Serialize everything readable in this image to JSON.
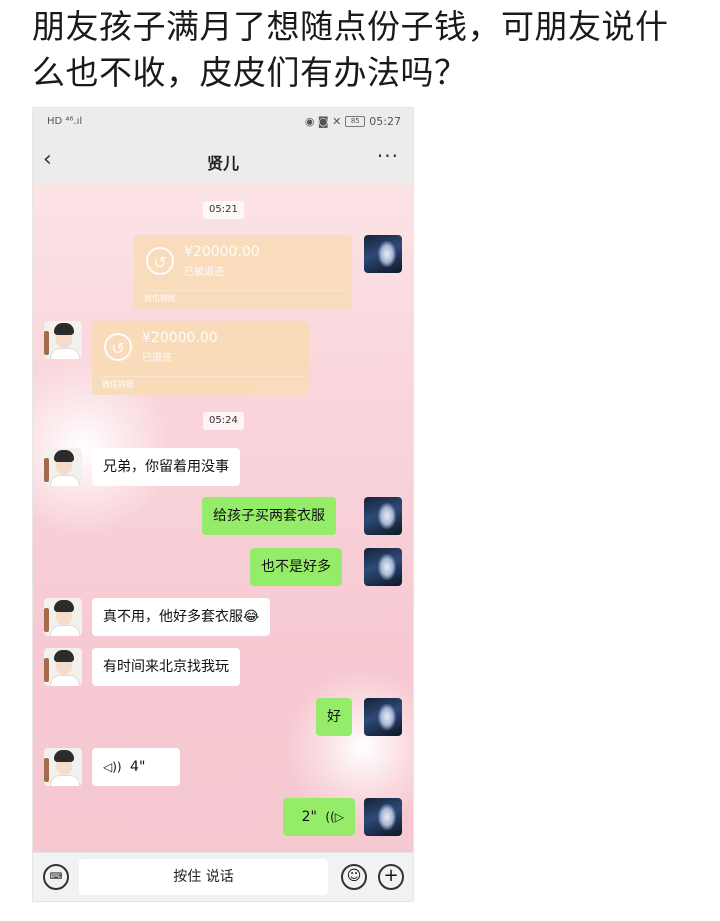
{
  "post": {
    "title": "朋友孩子满月了想随点份子钱，可朋友说什么也不收，皮皮们有办法吗？"
  },
  "phone": {
    "status_bar": {
      "left": "HD ⁴⁶.ıl",
      "icons": "◉ ◙ ✕",
      "battery": "85",
      "time": "05:27"
    },
    "nav": {
      "back": "‹",
      "title": "贤儿",
      "more": "···"
    },
    "chat": {
      "time1": "05:21",
      "transfer_sent": {
        "amount": "¥20000.00",
        "status": "已被退还",
        "footer": "微信转账"
      },
      "transfer_received": {
        "amount": "¥20000.00",
        "status": "已退还",
        "footer": "微信转账"
      },
      "time2": "05:24",
      "m1": "兄弟，你留着用没事",
      "m2": "给孩子买两套衣服",
      "m3": "也不是好多",
      "m4": "真不用，他好多套衣服😂",
      "m5": "有时间来北京找我玩",
      "m6": "好",
      "voice_in": {
        "icon": "◁))",
        "duration": "4\""
      },
      "voice_out": {
        "icon": "((▷",
        "duration": "2\""
      }
    },
    "input_bar": {
      "keyboard_icon": "⌨",
      "press_to_talk": "按住 说话",
      "emoji_icon": "☺",
      "plus_icon": "+"
    }
  }
}
